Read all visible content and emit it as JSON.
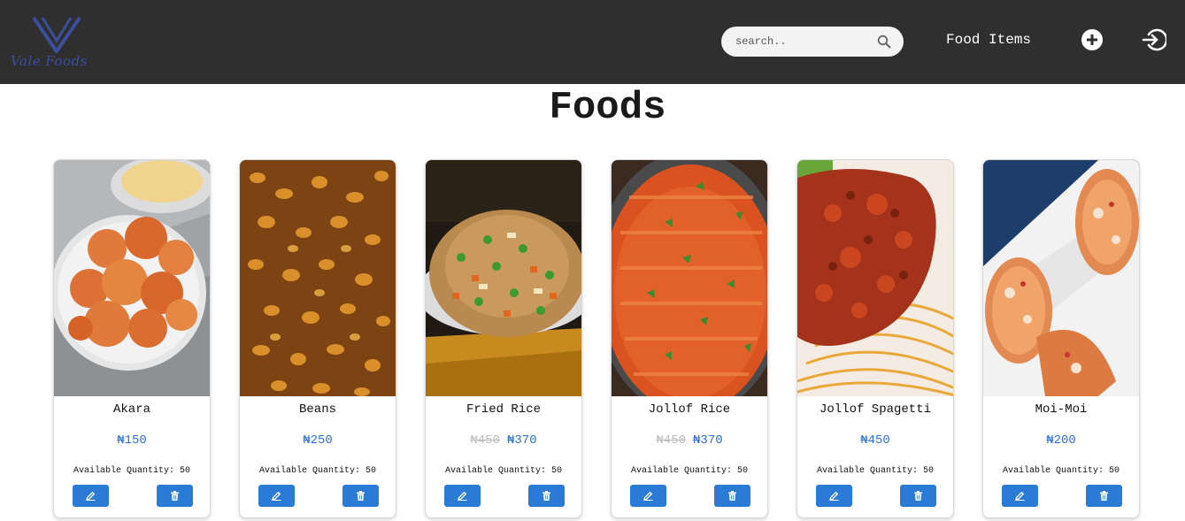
{
  "brand": {
    "logo_text": "Vale Foods",
    "accent_color": "#3b4f9e"
  },
  "navbar": {
    "search_placeholder": "search..",
    "food_items_link": "Food Items",
    "add_icon": "plus-circle-icon",
    "login_icon": "sign-in-icon"
  },
  "page": {
    "title": "Foods"
  },
  "colors": {
    "navbar_bg": "#2f2f2f",
    "price": "#2a6fd6",
    "button": "#2a7bd6"
  },
  "foods": [
    {
      "name": "Akara",
      "old_price": "",
      "price": "₦150",
      "quantity": "Available Quantity: 50",
      "image": "akara-photo"
    },
    {
      "name": "Beans",
      "old_price": "",
      "price": "₦250",
      "quantity": "Available Quantity: 50",
      "image": "beans-photo"
    },
    {
      "name": "Fried Rice",
      "old_price": "₦450",
      "price": "₦370",
      "quantity": "Available Quantity: 50",
      "image": "fried-rice-photo"
    },
    {
      "name": "Jollof Rice",
      "old_price": "₦450",
      "price": "₦370",
      "quantity": "Available Quantity: 50",
      "image": "jollof-rice-photo"
    },
    {
      "name": "Jollof Spagetti",
      "old_price": "",
      "price": "₦450",
      "quantity": "Available Quantity: 50",
      "image": "jollof-spagetti-photo"
    },
    {
      "name": "Moi-Moi",
      "old_price": "",
      "price": "₦200",
      "quantity": "Available Quantity: 50",
      "image": "moi-moi-photo"
    }
  ]
}
